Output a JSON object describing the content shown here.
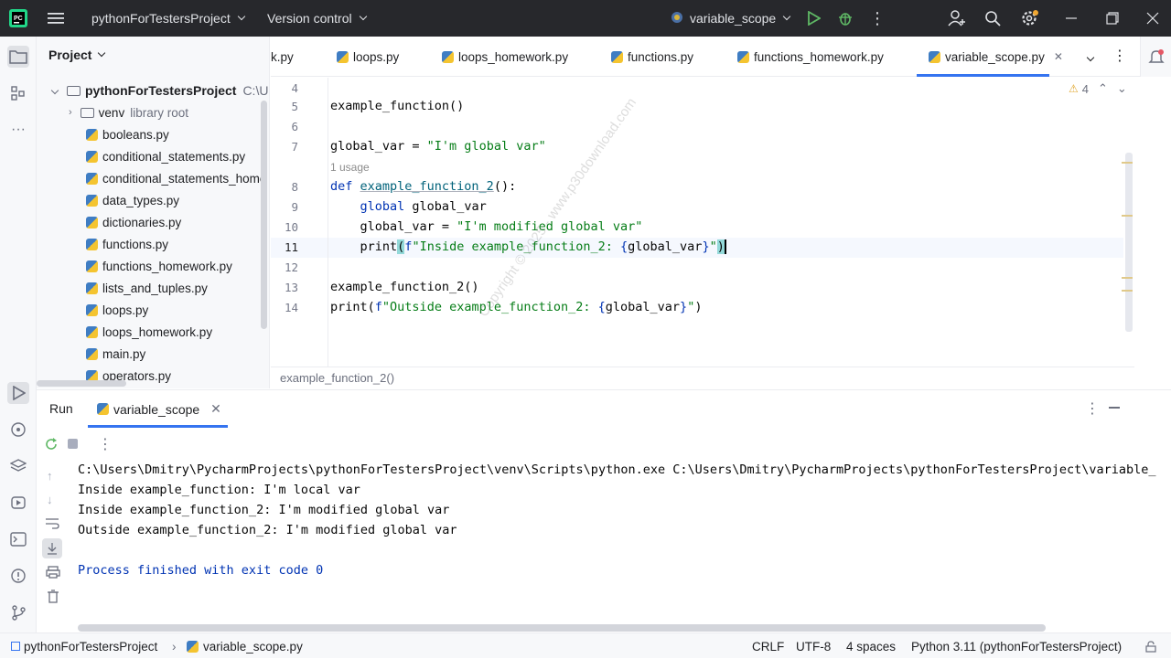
{
  "titlebar": {
    "project_name": "pythonForTestersProject",
    "vcs_label": "Version control",
    "run_config": "variable_scope"
  },
  "project_panel": {
    "title": "Project",
    "root": "pythonForTestersProject",
    "root_path": "C:\\U",
    "venv": "venv",
    "venv_hint": "library root",
    "files": [
      "booleans.py",
      "conditional_statements.py",
      "conditional_statements_home",
      "data_types.py",
      "dictionaries.py",
      "functions.py",
      "functions_homework.py",
      "lists_and_tuples.py",
      "loops.py",
      "loops_homework.py",
      "main.py",
      "operators.py"
    ]
  },
  "tabs": [
    {
      "label": "k.py"
    },
    {
      "label": "loops.py"
    },
    {
      "label": "loops_homework.py"
    },
    {
      "label": "functions.py"
    },
    {
      "label": "functions_homework.py"
    },
    {
      "label": "variable_scope.py",
      "active": true
    }
  ],
  "editor": {
    "warnings": "4",
    "usage_hint": "1 usage",
    "lines": [
      {
        "n": "4",
        "text": ""
      },
      {
        "n": "5",
        "text": "example_function()"
      },
      {
        "n": "6",
        "text": ""
      },
      {
        "n": "7",
        "text": "global_var = \"I'm global var\""
      },
      {
        "n": "8",
        "text": "def example_function_2():"
      },
      {
        "n": "9",
        "text": "    global global_var"
      },
      {
        "n": "10",
        "text": "    global_var = \"I'm modified global var\""
      },
      {
        "n": "11",
        "text": "    print(f\"Inside example_function_2: {global_var}\")"
      },
      {
        "n": "12",
        "text": ""
      },
      {
        "n": "13",
        "text": "example_function_2()"
      },
      {
        "n": "14",
        "text": "print(f\"Outside example_function_2: {global_var}\")"
      }
    ],
    "breadcrumb": "example_function_2()"
  },
  "run_panel": {
    "title": "Run",
    "tab": "variable_scope",
    "output": [
      "C:\\Users\\Dmitry\\PycharmProjects\\pythonForTestersProject\\venv\\Scripts\\python.exe C:\\Users\\Dmitry\\PycharmProjects\\pythonForTestersProject\\variable_",
      "Inside example_function: I'm local var",
      "Inside example_function_2: I'm modified global var",
      "Outside example_function_2: I'm modified global var",
      "",
      "Process finished with exit code 0"
    ]
  },
  "statusbar": {
    "project": "pythonForTestersProject",
    "file": "variable_scope.py",
    "line_sep": "CRLF",
    "encoding": "UTF-8",
    "indent": "4 spaces",
    "interpreter": "Python 3.11 (pythonForTestersProject)"
  },
  "watermark": "Copyright © 2025 - www.p30download.com",
  "colors": {
    "accent": "#3574f0",
    "titlebar": "#27282c",
    "run_green": "#4caf50",
    "string": "#067d17",
    "keyword": "#0033b3"
  }
}
